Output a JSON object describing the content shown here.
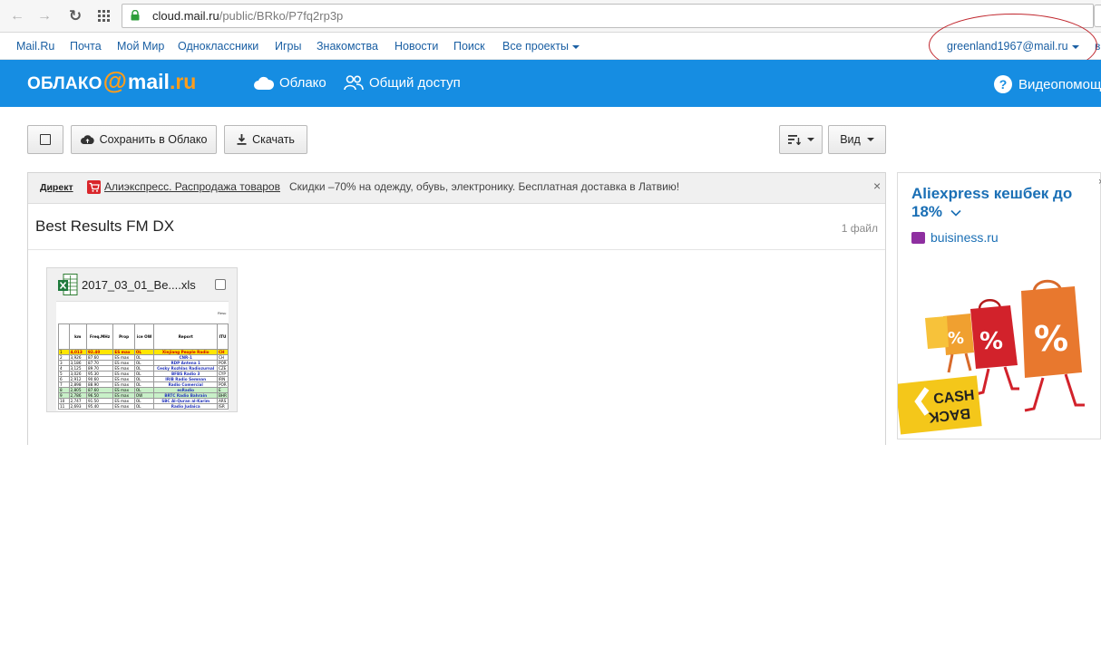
{
  "browser": {
    "url_host": "cloud.mail.ru",
    "url_path": "/public/BRko/P7fq2rp3p"
  },
  "portal": {
    "links": [
      "Mail.Ru",
      "Почта",
      "Мой Мир",
      "Одноклассники",
      "Игры",
      "Знакомства",
      "Новости",
      "Поиск"
    ],
    "all_projects": "Все проекты",
    "user_email": "greenland1967@mail.ru",
    "edge_char": "в"
  },
  "header": {
    "logo_oblako": "ОБЛАКО",
    "logo_at": "@",
    "logo_mail": "mail",
    "logo_ru": ".ru",
    "nav_cloud": "Облако",
    "nav_shared": "Общий доступ",
    "nav_help": "Видеопомощь"
  },
  "toolbar": {
    "save_to_cloud": "Сохранить в Облако",
    "download": "Скачать",
    "view": "Вид"
  },
  "ad_strip": {
    "direkt": "Директ",
    "link": "Алиэкспресс. Распродажа товаров",
    "text": "Скидки –70% на одежду, обувь, электронику. Бесплатная доставка в Латвию!",
    "close": "×"
  },
  "folder": {
    "title": "Best Results FM DX",
    "count": "1 файл"
  },
  "file": {
    "name": "2017_03_01_Be....xls",
    "thumb_corner": "Resu",
    "thumb_headers": [
      "km",
      "Freq.MHz",
      "Prop",
      "ice OW",
      "Report",
      "ITU"
    ],
    "thumb_rows": [
      [
        "1",
        "4,013",
        "92.40",
        "ES max",
        "OL",
        "Xinjiang People Radio",
        "CH"
      ],
      [
        "2",
        "3,926",
        "87.60",
        "ES max",
        "OL",
        "CNR-1",
        "CH"
      ],
      [
        "3",
        "3,186",
        "87.70",
        "ES max",
        "OL",
        "RDP Antena 1",
        "POR"
      ],
      [
        "4",
        "3,125",
        "89.70",
        "ES max",
        "OL",
        "Cesky Rozhlas Radiozurnal",
        "CZE"
      ],
      [
        "5",
        "3,026",
        "95.30",
        "ES max",
        "OL",
        "BFBS Radio 3",
        "CYP"
      ],
      [
        "6",
        "2,912",
        "90.60",
        "ES max",
        "OL",
        "IRIB Radio Semnan",
        "IRN"
      ],
      [
        "7",
        "2,898",
        "88.90",
        "ES max",
        "OL",
        "Radio Comercial",
        "POR"
      ],
      [
        "8",
        "2,805",
        "87.60",
        "ES max",
        "OL",
        "esRadio",
        "E"
      ],
      [
        "9",
        "2,786",
        "96.50",
        "ES max",
        "OW",
        "BRTC Radio Bahrain",
        "BHR"
      ],
      [
        "10",
        "2,747",
        "91.50",
        "ES max",
        "OL",
        "SBC Al-Quran al-Karim",
        "ARS"
      ],
      [
        "11",
        "2,693",
        "95.40",
        "ES max",
        "OL",
        "Radio Judaica",
        "ISR"
      ]
    ]
  },
  "side_ad": {
    "title": "Aliexpress кешбек до 18%",
    "domain": "buisiness.ru",
    "cash": "CASH",
    "back": "BACK",
    "percent": "%",
    "close": "×"
  },
  "colors": {
    "header_blue": "#168de2",
    "link_blue": "#1a5fa3",
    "accent_orange": "#ff9d1a",
    "annotation_red": "#c0262d"
  }
}
